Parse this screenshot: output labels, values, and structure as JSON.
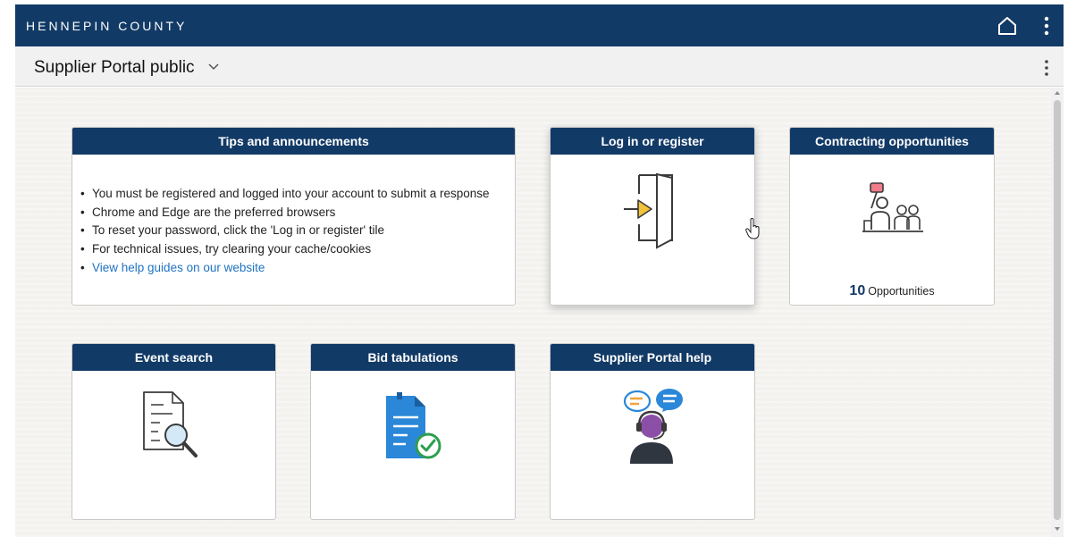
{
  "header": {
    "brand": "HENNEPIN COUNTY",
    "home_icon": "home-icon",
    "menu_icon": "kebab-icon"
  },
  "subheader": {
    "title": "Supplier Portal public",
    "dropdown_icon": "chevron-down-icon",
    "menu_icon": "kebab-icon"
  },
  "tiles": {
    "tips": {
      "title": "Tips and announcements",
      "items": [
        "You must be registered and logged into your account to submit a response",
        "Chrome and Edge are the preferred browsers",
        "To reset your password, click the 'Log in or register' tile",
        "For technical issues, try clearing your cache/cookies"
      ],
      "link": "View help guides on our website"
    },
    "login": {
      "title": "Log in or register",
      "icon": "door-enter-icon"
    },
    "contracting": {
      "title": "Contracting opportunities",
      "icon": "meeting-presentation-icon",
      "count": "10",
      "count_label": "Opportunities"
    },
    "event_search": {
      "title": "Event search",
      "icon": "document-search-icon"
    },
    "bid_tabulations": {
      "title": "Bid tabulations",
      "icon": "document-check-icon"
    },
    "help": {
      "title": "Supplier Portal help",
      "icon": "support-agent-icon"
    }
  },
  "colors": {
    "header_bg": "#123a66",
    "link": "#1f73c1",
    "accent_green": "#2e9e4f",
    "accent_orange": "#f2a33a",
    "accent_blue": "#2b87d8",
    "accent_purple": "#8b4fa8"
  }
}
